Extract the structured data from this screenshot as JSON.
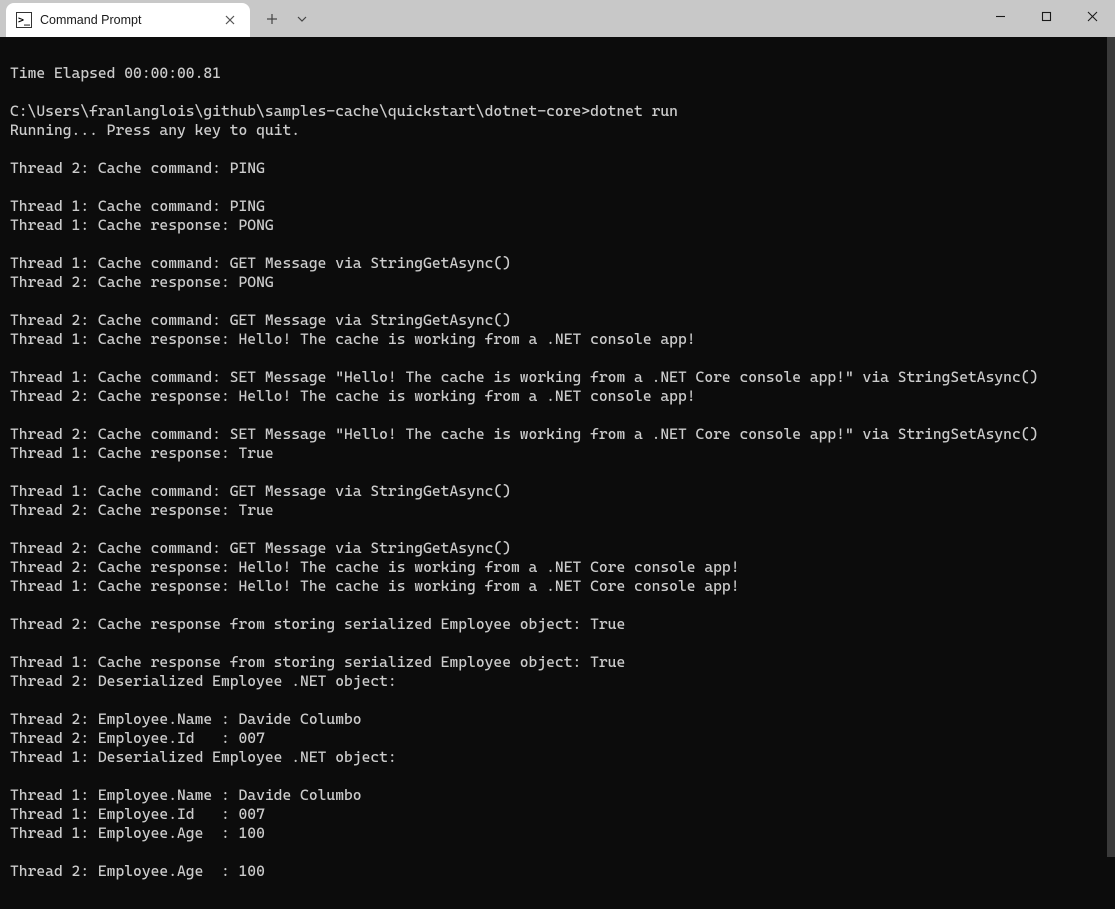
{
  "window": {
    "tab_title": "Command Prompt",
    "tab_icon_text": "C:\\"
  },
  "terminal_lines": [
    "",
    "Time Elapsed 00:00:00.81",
    "",
    "C:\\Users\\franlanglois\\github\\samples-cache\\quickstart\\dotnet-core>dotnet run",
    "Running... Press any key to quit.",
    "",
    "Thread 2: Cache command: PING",
    "",
    "Thread 1: Cache command: PING",
    "Thread 1: Cache response: PONG",
    "",
    "Thread 1: Cache command: GET Message via StringGetAsync()",
    "Thread 2: Cache response: PONG",
    "",
    "Thread 2: Cache command: GET Message via StringGetAsync()",
    "Thread 1: Cache response: Hello! The cache is working from a .NET console app!",
    "",
    "Thread 1: Cache command: SET Message \"Hello! The cache is working from a .NET Core console app!\" via StringSetAsync()",
    "Thread 2: Cache response: Hello! The cache is working from a .NET console app!",
    "",
    "Thread 2: Cache command: SET Message \"Hello! The cache is working from a .NET Core console app!\" via StringSetAsync()",
    "Thread 1: Cache response: True",
    "",
    "Thread 1: Cache command: GET Message via StringGetAsync()",
    "Thread 2: Cache response: True",
    "",
    "Thread 2: Cache command: GET Message via StringGetAsync()",
    "Thread 2: Cache response: Hello! The cache is working from a .NET Core console app!",
    "Thread 1: Cache response: Hello! The cache is working from a .NET Core console app!",
    "",
    "Thread 2: Cache response from storing serialized Employee object: True",
    "",
    "Thread 1: Cache response from storing serialized Employee object: True",
    "Thread 2: Deserialized Employee .NET object:",
    "",
    "Thread 2: Employee.Name : Davide Columbo",
    "Thread 2: Employee.Id   : 007",
    "Thread 1: Deserialized Employee .NET object:",
    "",
    "Thread 1: Employee.Name : Davide Columbo",
    "Thread 1: Employee.Id   : 007",
    "Thread 1: Employee.Age  : 100",
    "",
    "Thread 2: Employee.Age  : 100",
    ""
  ]
}
